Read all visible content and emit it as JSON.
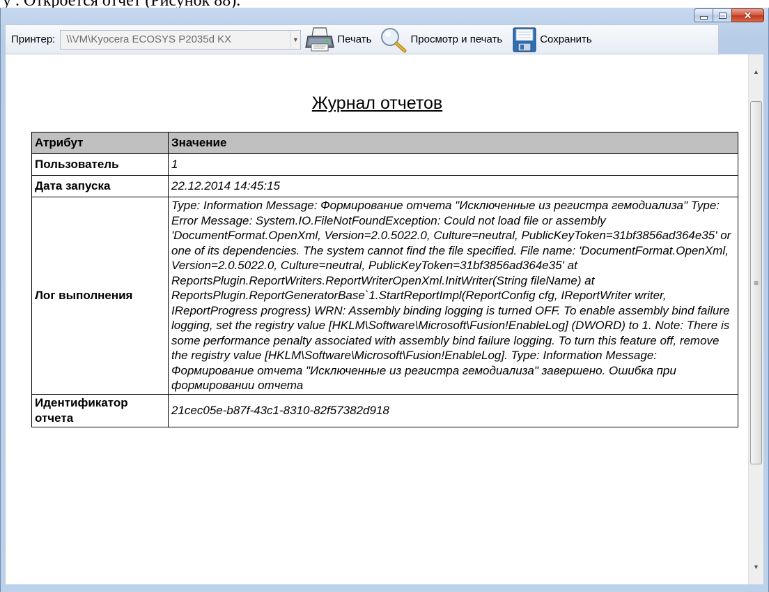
{
  "doc_fragment": "у . Откроется отчет (Рисунок 88).",
  "toolbar": {
    "printer_label": "Принтер:",
    "printer_value": "\\\\VM\\Kyocera ECOSYS P2035d KX",
    "print_label": "Печать",
    "preview_label": "Просмотр и печать",
    "save_label": "Сохранить"
  },
  "report": {
    "title": "Журнал отчетов",
    "headers": [
      "Атрибут",
      "Значение"
    ],
    "rows": [
      {
        "key": "Пользователь",
        "value": "1"
      },
      {
        "key": "Дата запуска",
        "value": "22.12.2014 14:45:15"
      },
      {
        "key": "Лог выполнения",
        "value": "Type: Information Message: Формирование отчета \"Исключенные из регистра гемодиализа\" Type: Error Message: System.IO.FileNotFoundException: Could not load file or assembly 'DocumentFormat.OpenXml, Version=2.0.5022.0, Culture=neutral, PublicKeyToken=31bf3856ad364e35' or one of its dependencies. The system cannot find the file specified. File name: 'DocumentFormat.OpenXml, Version=2.0.5022.0, Culture=neutral, PublicKeyToken=31bf3856ad364e35' at ReportsPlugin.ReportWriters.ReportWriterOpenXml.InitWriter(String fileName) at ReportsPlugin.ReportGeneratorBase`1.StartReportImpl(ReportConfig cfg, IReportWriter writer, IReportProgress progress) WRN: Assembly binding logging is turned OFF. To enable assembly bind failure logging, set the registry value [HKLM\\Software\\Microsoft\\Fusion!EnableLog] (DWORD) to 1. Note: There is some performance penalty associated with assembly bind failure logging. To turn this feature off, remove the registry value [HKLM\\Software\\Microsoft\\Fusion!EnableLog]. Type: Information Message: Формирование отчета \"Исключенные из регистра гемодиализа\" завершено. Ошибка при формировании отчета"
      },
      {
        "key": "Идентификатор отчета",
        "value": "21cec05e-b87f-43c1-8310-82f57382d918"
      }
    ]
  }
}
